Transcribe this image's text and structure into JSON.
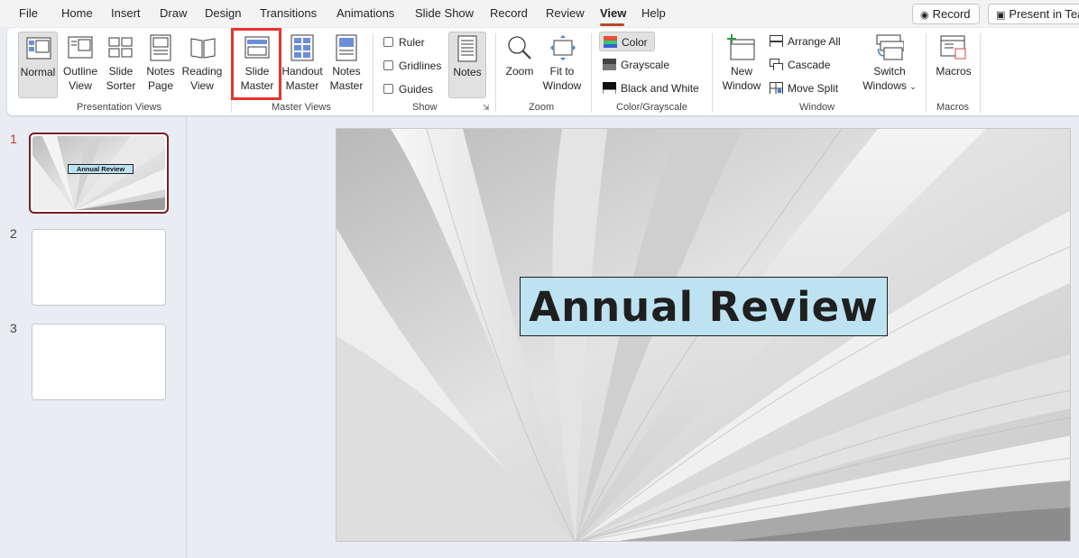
{
  "menu": {
    "items": [
      "File",
      "Home",
      "Insert",
      "Draw",
      "Design",
      "Transitions",
      "Animations",
      "Slide Show",
      "Record",
      "Review",
      "View",
      "Help"
    ],
    "active": "View",
    "record_button": "Record",
    "present_button": "Present in Tea"
  },
  "ribbon": {
    "presentation_views": {
      "label": "Presentation Views",
      "normal": "Normal",
      "outline": [
        "Outline",
        "View"
      ],
      "sorter": [
        "Slide",
        "Sorter"
      ],
      "notes_page": [
        "Notes",
        "Page"
      ],
      "reading": [
        "Reading",
        "View"
      ]
    },
    "master_views": {
      "label": "Master Views",
      "slide_master": [
        "Slide",
        "Master"
      ],
      "handout_master": [
        "Handout",
        "Master"
      ],
      "notes_master": [
        "Notes",
        "Master"
      ]
    },
    "show": {
      "label": "Show",
      "ruler": "Ruler",
      "gridlines": "Gridlines",
      "guides": "Guides",
      "notes": "Notes"
    },
    "zoom": {
      "label": "Zoom",
      "zoom": "Zoom",
      "fit": [
        "Fit to",
        "Window"
      ]
    },
    "color": {
      "label": "Color/Grayscale",
      "color": "Color",
      "grayscale": "Grayscale",
      "bw": "Black and White"
    },
    "window": {
      "label": "Window",
      "new_window": [
        "New",
        "Window"
      ],
      "arrange_all": "Arrange All",
      "cascade": "Cascade",
      "move_split": "Move Split",
      "switch": [
        "Switch",
        "Windows"
      ]
    },
    "macros": {
      "label": "Macros",
      "macros": "Macros"
    }
  },
  "slides": {
    "numbers": [
      "1",
      "2",
      "3"
    ],
    "active": 1,
    "thumb_title": "Annual Review"
  },
  "main_slide": {
    "title": "Annual Review"
  },
  "colors": {
    "accent": "#b7472a",
    "highlight": "#e8332f",
    "title_fill": "#bde3f3"
  }
}
